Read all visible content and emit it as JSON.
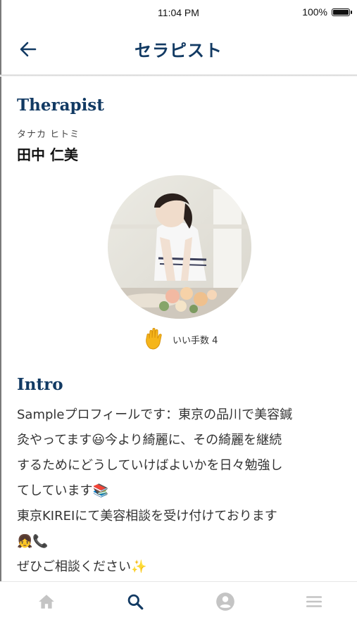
{
  "status_bar": {
    "time": "11:04 PM",
    "battery": "100%"
  },
  "header": {
    "title": "セラピスト",
    "back_icon": "arrow-left-icon"
  },
  "therapist": {
    "section_title": "Therapist",
    "name_kana": "タナカ ヒトミ",
    "name": "田中 仁美",
    "likes_label": "いい手数 4"
  },
  "intro": {
    "section_title": "Intro",
    "lines": [
      "Sampleプロフィールです：東京の品川で美容鍼",
      "灸やってます😃今より綺麗に、その綺麗を継続",
      "するためにどうしていけばよいかを日々勉強し",
      "てしています📚",
      "東京KIREIにて美容相談を受け付けております",
      "👧📞",
      "ぜひご相談ください✨"
    ]
  },
  "tabbar": {
    "items": [
      {
        "icon": "home-icon",
        "active": false
      },
      {
        "icon": "search-icon",
        "active": true
      },
      {
        "icon": "account-icon",
        "active": false
      },
      {
        "icon": "menu-icon",
        "active": false
      }
    ]
  },
  "colors": {
    "accent": "#123a63",
    "inactive": "#c4c4c4",
    "hand": "#f5b51b"
  }
}
